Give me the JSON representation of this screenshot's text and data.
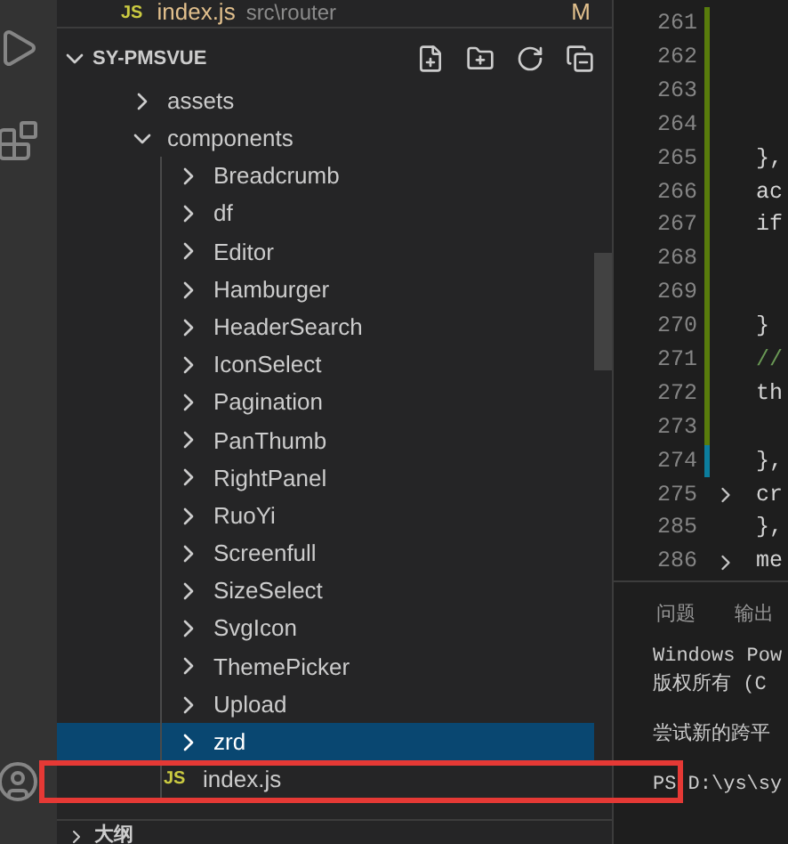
{
  "open_editor": {
    "icon": "JS",
    "name": "index.js",
    "path": "src\\router",
    "status": "M"
  },
  "explorer": {
    "title": "SY-PMSVUE",
    "expanded": true,
    "tree": [
      {
        "name": "assets",
        "kind": "folder",
        "expanded": false,
        "selected": false
      },
      {
        "name": "components",
        "kind": "folder",
        "expanded": true,
        "selected": false,
        "children": [
          {
            "name": "Breadcrumb",
            "kind": "folder",
            "expanded": false,
            "selected": false
          },
          {
            "name": "df",
            "kind": "folder",
            "expanded": false,
            "selected": false
          },
          {
            "name": "Editor",
            "kind": "folder",
            "expanded": false,
            "selected": false
          },
          {
            "name": "Hamburger",
            "kind": "folder",
            "expanded": false,
            "selected": false
          },
          {
            "name": "HeaderSearch",
            "kind": "folder",
            "expanded": false,
            "selected": false
          },
          {
            "name": "IconSelect",
            "kind": "folder",
            "expanded": false,
            "selected": false
          },
          {
            "name": "Pagination",
            "kind": "folder",
            "expanded": false,
            "selected": false
          },
          {
            "name": "PanThumb",
            "kind": "folder",
            "expanded": false,
            "selected": false
          },
          {
            "name": "RightPanel",
            "kind": "folder",
            "expanded": false,
            "selected": false
          },
          {
            "name": "RuoYi",
            "kind": "folder",
            "expanded": false,
            "selected": false
          },
          {
            "name": "Screenfull",
            "kind": "folder",
            "expanded": false,
            "selected": false
          },
          {
            "name": "SizeSelect",
            "kind": "folder",
            "expanded": false,
            "selected": false
          },
          {
            "name": "SvgIcon",
            "kind": "folder",
            "expanded": false,
            "selected": false
          },
          {
            "name": "ThemePicker",
            "kind": "folder",
            "expanded": false,
            "selected": false
          },
          {
            "name": "Upload",
            "kind": "folder",
            "expanded": false,
            "selected": false
          },
          {
            "name": "zrd",
            "kind": "folder",
            "expanded": false,
            "selected": true
          },
          {
            "name": "index.js",
            "kind": "js",
            "badge": "JS",
            "selected": false
          }
        ]
      }
    ]
  },
  "outline": {
    "title": "大纲",
    "expanded": false
  },
  "editor": {
    "lines": [
      {
        "number": "261",
        "color": "#587c0c",
        "folded": false
      },
      {
        "number": "262",
        "color": "#587c0c",
        "folded": false
      },
      {
        "number": "263",
        "color": "#587c0c",
        "folded": false
      },
      {
        "number": "264",
        "color": "#587c0c",
        "folded": false
      },
      {
        "number": "265",
        "code": "},",
        "color": "#587c0c",
        "folded": false
      },
      {
        "number": "266",
        "code": "ac",
        "color": "#587c0c",
        "folded": false
      },
      {
        "number": "267",
        "code": "if",
        "color": "#587c0c",
        "folded": false
      },
      {
        "number": "268",
        "color": "#587c0c",
        "folded": false
      },
      {
        "number": "269",
        "color": "#587c0c",
        "folded": false
      },
      {
        "number": "270",
        "code": "}",
        "color": "#587c0c",
        "folded": false
      },
      {
        "number": "271",
        "code": "//",
        "color": "#587c0c",
        "folded": false
      },
      {
        "number": "272",
        "code": "th",
        "color": "#587c0c",
        "folded": false
      },
      {
        "number": "273",
        "color": "#587c0c",
        "folded": false
      },
      {
        "number": "274",
        "code": "},",
        "color": "#0c7d9d",
        "folded": false
      },
      {
        "number": "275",
        "code": "cr",
        "folded": true
      },
      {
        "number": "285",
        "code": "},",
        "folded": false
      },
      {
        "number": "286",
        "code": "me",
        "folded": true
      }
    ]
  },
  "panel": {
    "tabs": [
      {
        "label": "问题",
        "selected": false
      },
      {
        "label": "输出",
        "selected": false
      }
    ],
    "terminal": [
      {
        "lines": [
          "Windows Pow",
          "版权所有 (C"
        ]
      },
      {
        "lines": [
          "尝试新的跨平"
        ]
      },
      {
        "lines": [
          "PS D:\\ys\\sy"
        ]
      }
    ]
  }
}
